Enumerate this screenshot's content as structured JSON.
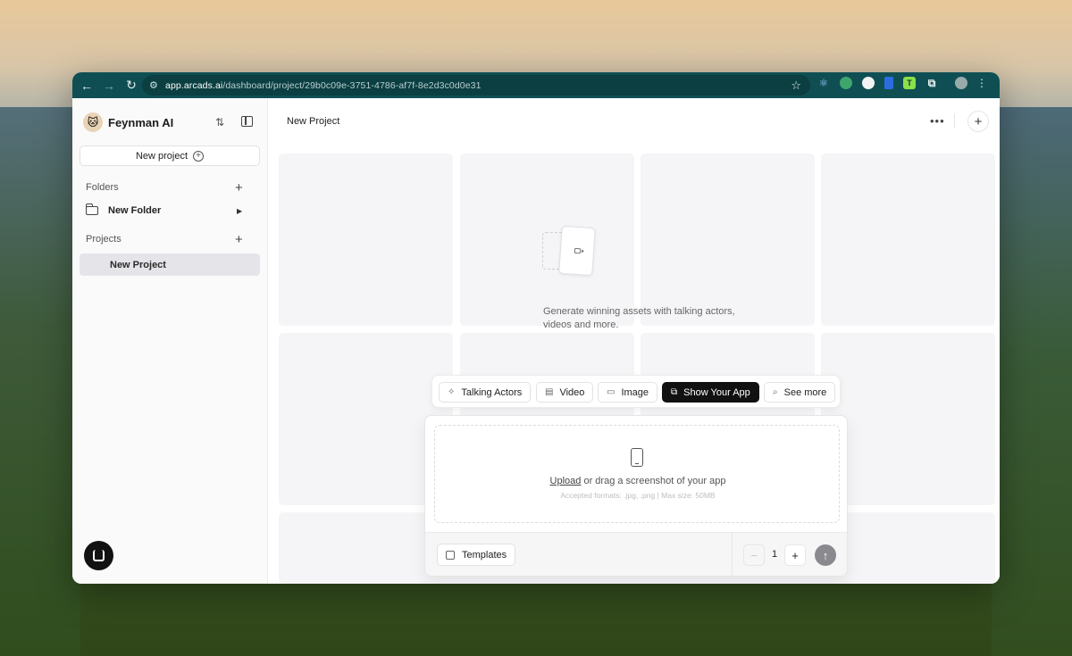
{
  "browser": {
    "url_host": "app.arcads.ai",
    "url_path": "/dashboard/project/29b0c09e-3751-4786-af7f-8e2d3c0d0e31",
    "extension_lime_letter": "T"
  },
  "sidebar": {
    "brand_name": "Feynman AI",
    "new_project_label": "New project",
    "folders_label": "Folders",
    "folders": [
      {
        "label": "New Folder"
      }
    ],
    "projects_label": "Projects",
    "projects": [
      {
        "label": "New Project",
        "selected": true
      }
    ]
  },
  "main": {
    "title": "New Project",
    "empty_state_text": "Generate winning assets with talking actors, videos and more.",
    "modes": [
      {
        "label": "Talking Actors",
        "icon": "sparkle-face-icon"
      },
      {
        "label": "Video",
        "icon": "clapper-icon"
      },
      {
        "label": "Image",
        "icon": "image-icon"
      },
      {
        "label": "Show Your App",
        "icon": "app-screenshot-icon",
        "active": true
      },
      {
        "label": "See more",
        "icon": "search-icon"
      }
    ],
    "composer": {
      "upload_link": "Upload",
      "upload_text": " or drag a screenshot of your app",
      "hint": "Accepted formats: .jpg, .png | Max size: 50MB",
      "templates_label": "Templates",
      "quantity": "1",
      "minus": "−",
      "plus": "+"
    }
  },
  "colors": {
    "browser_bar": "#0f4f53",
    "active_mode": "#111111",
    "selected_row": "#e5e5e9"
  }
}
